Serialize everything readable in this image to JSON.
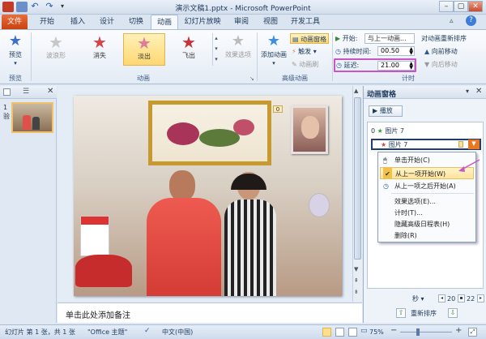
{
  "window": {
    "title": "演示文稿1.pptx - Microsoft PowerPoint"
  },
  "tabs": [
    {
      "label": "文件"
    },
    {
      "label": "开始"
    },
    {
      "label": "插入"
    },
    {
      "label": "设计"
    },
    {
      "label": "切换"
    },
    {
      "label": "动画"
    },
    {
      "label": "幻灯片放映"
    },
    {
      "label": "审阅"
    },
    {
      "label": "视图"
    },
    {
      "label": "开发工具"
    }
  ],
  "ribbon": {
    "preview": {
      "button": "预览",
      "group": "预览"
    },
    "animation": {
      "effects": [
        {
          "label": "波浪形"
        },
        {
          "label": "消失"
        },
        {
          "label": "淡出"
        },
        {
          "label": "飞出"
        }
      ],
      "effect_options": "效果选项",
      "group": "动画"
    },
    "advanced": {
      "add_animation": "添加动画",
      "animation_pane": "动画窗格",
      "trigger": "触发",
      "painter": "动画刷",
      "group": "高级动画"
    },
    "timing": {
      "start_label": "开始:",
      "start_value": "与上一动画...",
      "duration_label": "持续时间:",
      "duration_value": "00.50",
      "delay_label": "延迟:",
      "delay_value": "21.00",
      "reorder_title": "对动画重新排序",
      "move_earlier": "向前移动",
      "move_later": "向后移动",
      "group": "计时"
    }
  },
  "thumbs": {
    "number": "1",
    "sub": "验"
  },
  "slide": {
    "badge": "0"
  },
  "notes": {
    "placeholder": "单击此处添加备注"
  },
  "anim_pane": {
    "title": "动画窗格",
    "play": "播放",
    "items": [
      {
        "num": "0",
        "name": "图片 7"
      },
      {
        "num": "",
        "name": "图片 7"
      }
    ],
    "menu": [
      {
        "label": "单击开始(C)"
      },
      {
        "label": "从上一项开始(W)"
      },
      {
        "label": "从上一项之后开始(A)"
      },
      {
        "label": "效果选项(E)..."
      },
      {
        "label": "计时(T)..."
      },
      {
        "label": "隐藏高级日程表(H)"
      },
      {
        "label": "删除(R)"
      }
    ],
    "seconds_label": "秒 ▾",
    "ticks": [
      "20",
      "22"
    ],
    "reorder": "重新排序"
  },
  "status": {
    "slide_info": "幻灯片 第 1 张，共 1 张",
    "theme": "\"Office 主题\"",
    "language": "中文(中国)",
    "zoom": "75%"
  },
  "colors": {
    "accent": "#c8410f",
    "selection_border": "#c855c8",
    "ribbon_border": "#a9bdd6"
  }
}
